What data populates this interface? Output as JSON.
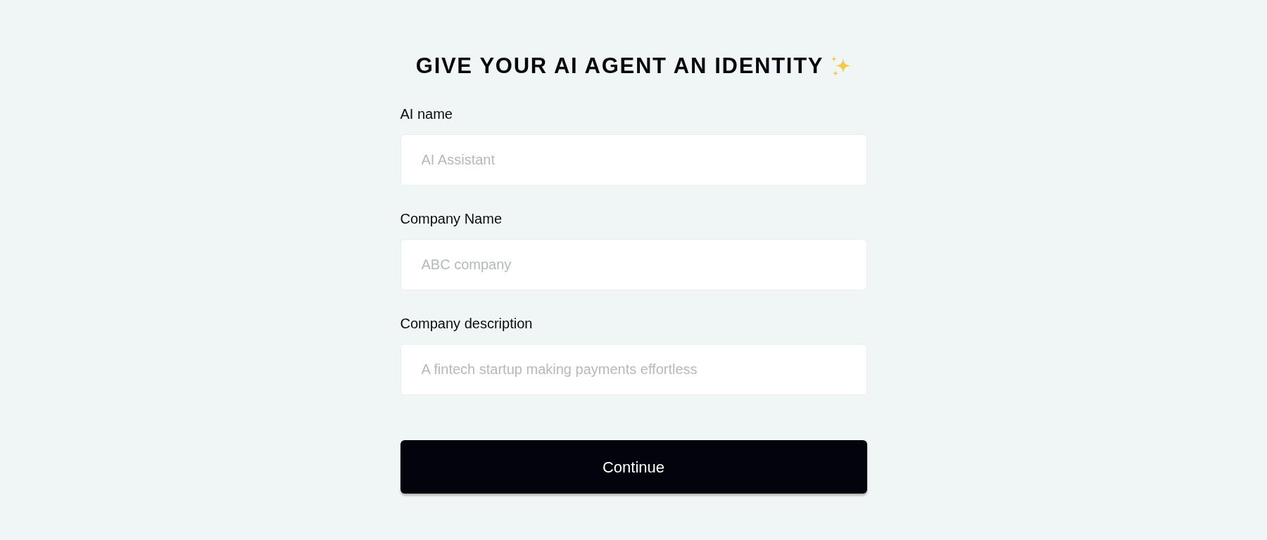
{
  "title": "GIVE YOUR AI AGENT AN IDENTITY",
  "fields": [
    {
      "label": "AI name",
      "placeholder": "AI Assistant"
    },
    {
      "label": "Company Name",
      "placeholder": "ABC company"
    },
    {
      "label": "Company description",
      "placeholder": "A fintech startup making payments effortless"
    }
  ],
  "button": {
    "label": "Continue"
  }
}
